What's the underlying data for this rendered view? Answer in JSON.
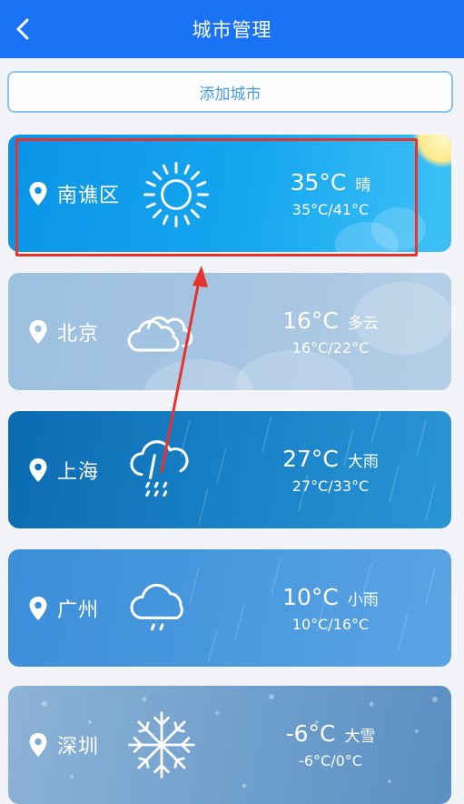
{
  "appbar": {
    "title": "城市管理",
    "back_icon": "chevron-left-icon"
  },
  "add_city": {
    "label": "添加城市"
  },
  "cities": [
    {
      "name": "南谯区",
      "temp": "35°C",
      "desc": "晴",
      "range": "35°C/41°C",
      "icon": "sun-icon"
    },
    {
      "name": "北京",
      "temp": "16°C",
      "desc": "多云",
      "range": "16°C/22°C",
      "icon": "cloudy-icon"
    },
    {
      "name": "上海",
      "temp": "27°C",
      "desc": "大雨",
      "range": "27°C/33°C",
      "icon": "heavy-rain-icon"
    },
    {
      "name": "广州",
      "temp": "10°C",
      "desc": "小雨",
      "range": "10°C/16°C",
      "icon": "light-rain-icon"
    },
    {
      "name": "深圳",
      "temp": "-6°C",
      "desc": "大雪",
      "range": "-6°C/0°C",
      "icon": "snowflake-icon"
    }
  ],
  "colors": {
    "appbar": "#1a73f5",
    "highlight": "#e8322c",
    "add_border": "#8ec3ee"
  }
}
